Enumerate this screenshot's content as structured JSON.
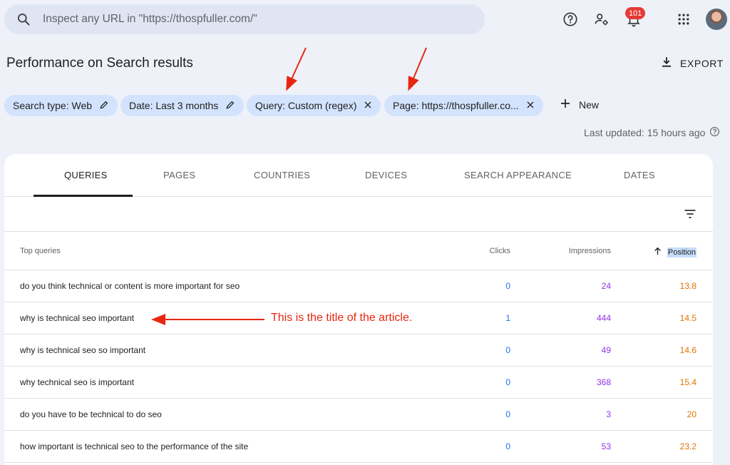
{
  "search": {
    "placeholder": "Inspect any URL in \"https://thospfuller.com/\""
  },
  "header": {
    "notification_count": "101"
  },
  "page": {
    "title": "Performance on Search results",
    "export_label": "EXPORT"
  },
  "filters": [
    {
      "label": "Search type: Web",
      "action": "edit"
    },
    {
      "label": "Date: Last 3 months",
      "action": "edit"
    },
    {
      "label": "Query: Custom (regex)",
      "action": "remove"
    },
    {
      "label": "Page: https://thospfuller.co...",
      "action": "remove"
    }
  ],
  "new_label": "New",
  "last_updated": "Last updated: 15 hours ago",
  "tabs": [
    "QUERIES",
    "PAGES",
    "COUNTRIES",
    "DEVICES",
    "SEARCH APPEARANCE",
    "DATES"
  ],
  "table": {
    "headers": {
      "query": "Top queries",
      "clicks": "Clicks",
      "impressions": "Impressions",
      "position": "Position"
    },
    "rows": [
      {
        "query": "do you think technical or content is more important for seo",
        "clicks": "0",
        "impressions": "24",
        "position": "13.8"
      },
      {
        "query": "why is technical seo important",
        "clicks": "1",
        "impressions": "444",
        "position": "14.5"
      },
      {
        "query": "why is technical seo so important",
        "clicks": "0",
        "impressions": "49",
        "position": "14.6"
      },
      {
        "query": "why technical seo is important",
        "clicks": "0",
        "impressions": "368",
        "position": "15.4"
      },
      {
        "query": "do you have to be technical to do seo",
        "clicks": "0",
        "impressions": "3",
        "position": "20"
      },
      {
        "query": "how important is technical seo to the performance of the site",
        "clicks": "0",
        "impressions": "53",
        "position": "23.2"
      }
    ]
  },
  "annotation": {
    "text": "This is the title of the article."
  },
  "colors": {
    "clicks": "#1a73e8",
    "impressions": "#9334e6",
    "position": "#e37400",
    "annotation": "#e8260f",
    "chip": "#d3e3fd"
  },
  "icons": [
    "search-icon",
    "help-icon",
    "manage-accounts-icon",
    "bell-icon",
    "apps-icon",
    "download-icon",
    "pencil-icon",
    "close-icon",
    "plus-icon",
    "filter-icon",
    "arrow-up-icon"
  ]
}
